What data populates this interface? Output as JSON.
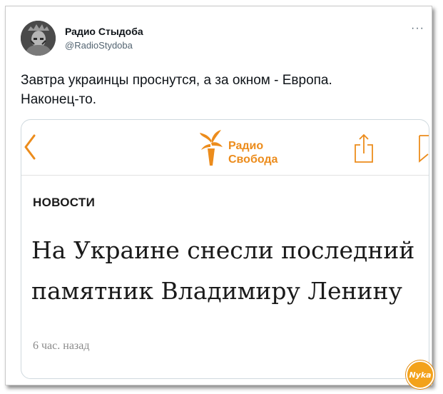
{
  "tweet": {
    "author_name": "Радио Стыдоба",
    "author_handle": "@RadioStydoba",
    "more_label": "···",
    "text_line1": "Завтра украинцы проснутся, а за окном - Европа.",
    "text_line2": "Наконец-то."
  },
  "card": {
    "logo_line1": "Радио",
    "logo_line2": "Свобода",
    "section_label": "НОВОСТИ",
    "headline_line1": "На Украине снесли последний",
    "headline_line2": "памятник Владимиру Ленину",
    "timestamp": "6 час. назад"
  },
  "watermark": {
    "text": "Nyka"
  },
  "icons": {
    "avatar": "statue-of-liberty-avatar",
    "back": "chevron-left-icon",
    "share": "share-icon",
    "bookmark": "bookmark-icon",
    "logo": "torch-logo-icon"
  },
  "colors": {
    "accent": "#ec8c1c",
    "text": "#0f1419",
    "muted": "#536471",
    "timestamp": "#8a8a8a"
  }
}
